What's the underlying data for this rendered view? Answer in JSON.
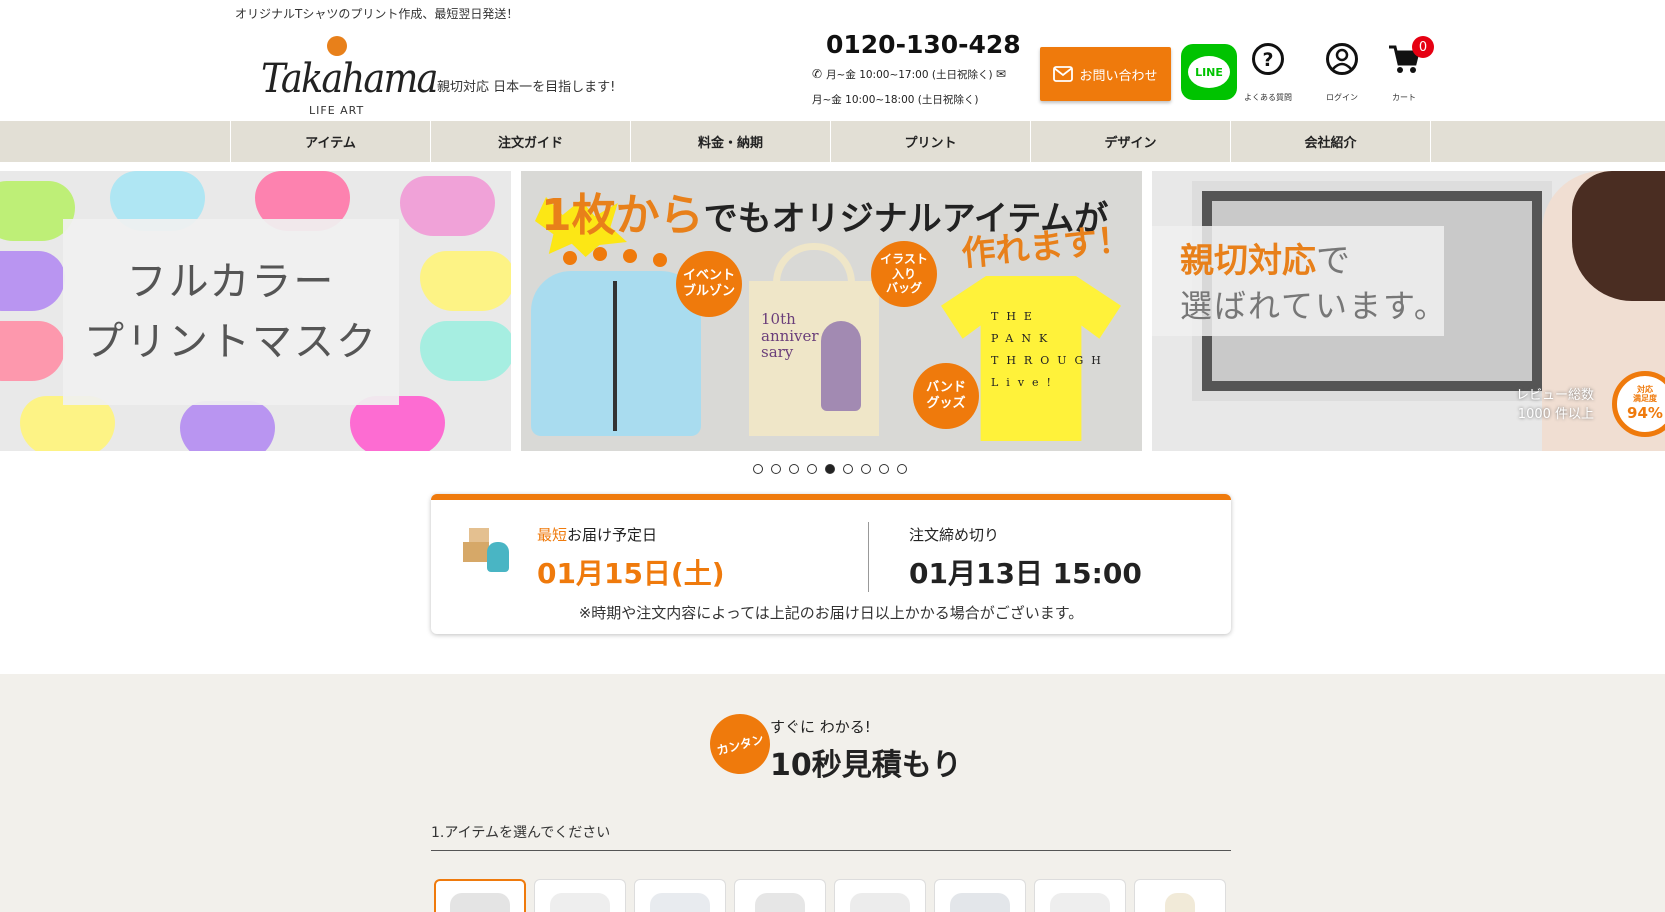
{
  "header": {
    "top_text": "オリジナルTシャツのプリント作成、最短翌日発送！",
    "logo_main": "Takahama",
    "logo_sub": "LIFE ART",
    "tagline": "親切対応 日本一を目指します!",
    "phone": "0120-130-428",
    "phone_hours": "月~金 10:00~17:00 (土日祝除く)",
    "mail_hours": "月~金 10:00~18:00 (土日祝除く)",
    "contact_label": "お問い合わせ",
    "line_label": "LINE",
    "faq_label": "よくある質問",
    "login_label": "ログイン",
    "cart_label": "カート",
    "cart_count": "0"
  },
  "nav": {
    "items": [
      "アイテム",
      "注文ガイド",
      "料金・納期",
      "プリント",
      "デザイン",
      "会社紹介"
    ]
  },
  "banners": {
    "left": {
      "line1": "フルカラー",
      "line2": "プリントマスク"
    },
    "center": {
      "head_accent": "1枚から",
      "head_rest": "でもオリジナルアイテムが",
      "head2": "作れます！",
      "badge_event": "イベント\nブルゾン",
      "badge_bag": "イラスト\n入り\nバッグ",
      "badge_band": "バンド\nグッズ",
      "tote_text": "10th\nanniver\nsary",
      "shirt_text": "THE\nPANK\nTHROUGH\nLive!"
    },
    "right": {
      "copy_accent": "親切対応",
      "copy_soft": "で",
      "copy2": "選ばれています。",
      "review": "レビュー総数\n1000 件以上",
      "sat_label": "対応\n満足度",
      "sat_value": "94%"
    },
    "slide_count": 9,
    "active_slide": 5
  },
  "delivery": {
    "label_hl": "最短",
    "label_rest": "お届け予定日",
    "date": "01月15日(土)",
    "cutoff_label": "注文締め切り",
    "cutoff_date": "01月13日 15:00",
    "note": "※時期や注文内容によっては上記のお届け日以上かかる場合がございます。"
  },
  "estimate": {
    "badge": "カンタン",
    "subtitle": "すぐに わかる!",
    "title": "10秒見積もり",
    "step1": "1.アイテムを選んでください",
    "item_count": 8
  },
  "colors": {
    "accent": "#ef7a0c",
    "nav_bg": "#e2dfd5",
    "line": "#00c300",
    "section_bg": "#f2f0eb"
  }
}
